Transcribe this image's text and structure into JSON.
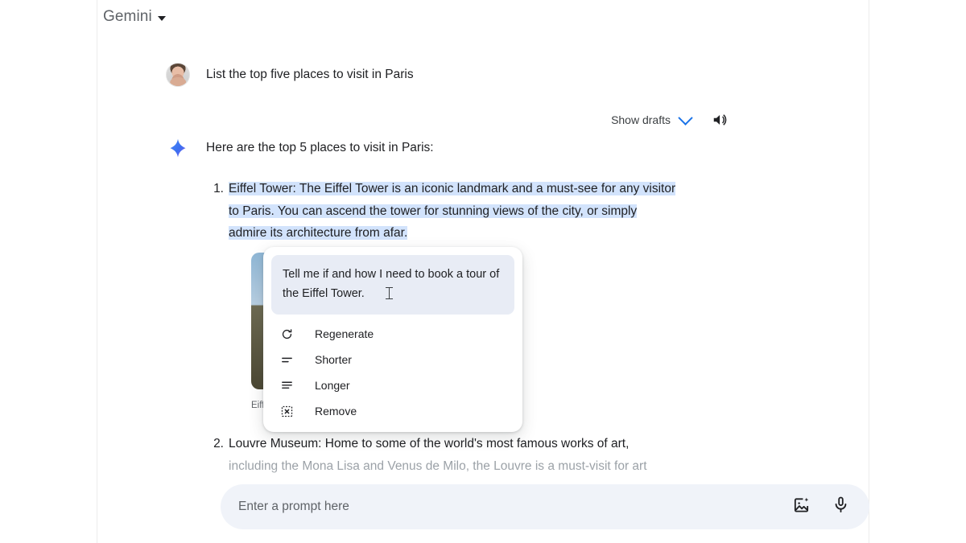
{
  "header": {
    "title": "Gemini",
    "caret_icon": "chevron-down-icon"
  },
  "conversation": {
    "user": {
      "avatar_icon": "user-avatar",
      "message": "List the top five places to visit in Paris"
    },
    "actions": {
      "show_drafts_label": "Show drafts",
      "chevron_icon": "chevron-down-icon",
      "speaker_icon": "speaker-icon"
    },
    "model": {
      "sparkle_icon": "gemini-sparkle-icon",
      "lead": "Here are the top 5 places to visit in Paris:",
      "items": [
        {
          "number": "1.",
          "selected": true,
          "lines": [
            "Eiffel Tower: The Eiffel Tower is an iconic landmark and a must-see for any visitor",
            "to Paris. You can ascend the tower for stunning views of the city, or simply",
            "admire its architecture from afar."
          ],
          "image_caption": "Eiffel Tower, Paris"
        },
        {
          "number": "2.",
          "selected": false,
          "lines": [
            "Louvre Museum: Home to some of the world's most famous works of art,",
            "including the Mona Lisa and Venus de Milo, the Louvre is a must-visit for art"
          ]
        }
      ]
    }
  },
  "popup": {
    "input_value": "Tell me if and how I need to book a tour of the Eiffel Tower.",
    "cursor_icon": "text-cursor-icon",
    "menu": [
      {
        "label": "Regenerate",
        "icon": "refresh-icon"
      },
      {
        "label": "Shorter",
        "icon": "shorter-lines-icon"
      },
      {
        "label": "Longer",
        "icon": "longer-lines-icon"
      },
      {
        "label": "Remove",
        "icon": "remove-box-icon"
      }
    ]
  },
  "composer": {
    "placeholder": "Enter a prompt here",
    "value": "",
    "image_icon": "add-image-icon",
    "mic_icon": "microphone-icon"
  },
  "colors": {
    "selection": "#d2e3fc",
    "accent_blue": "#1a73e8",
    "composer_bg": "#f0f3f9",
    "popup_input_bg": "#e8ecf5"
  }
}
